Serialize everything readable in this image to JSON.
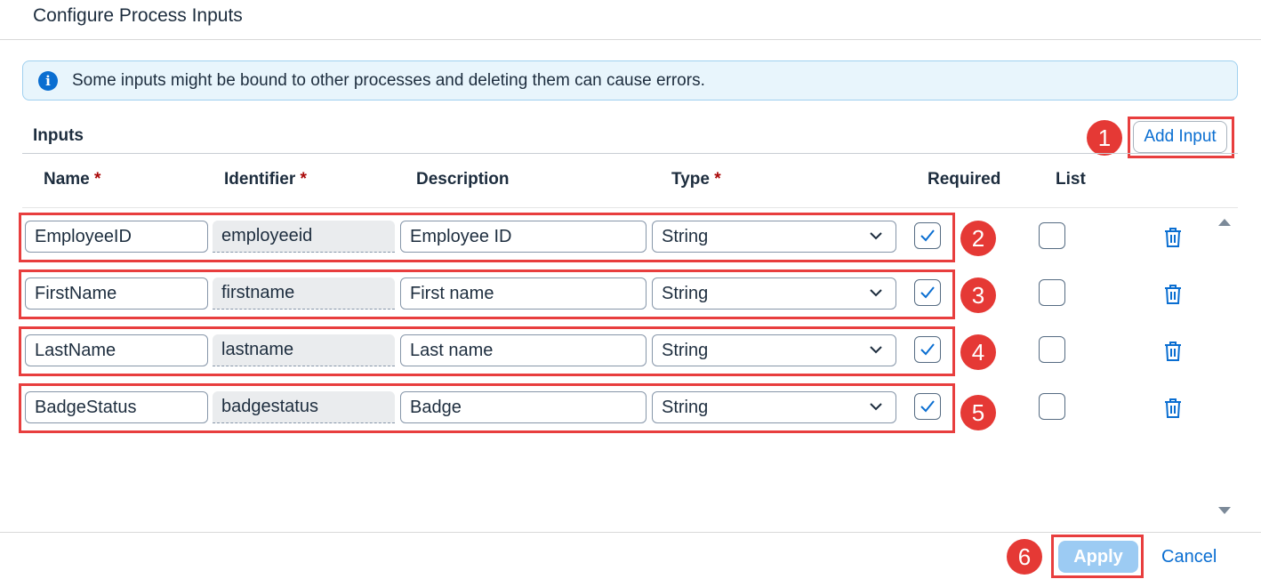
{
  "dialog": {
    "title": "Configure Process Inputs"
  },
  "info": {
    "icon": "info-icon",
    "text": "Some inputs might be bound to other processes and deleting them can cause errors."
  },
  "inputs": {
    "section_label": "Inputs",
    "add_label": "Add Input",
    "columns": {
      "name": "Name",
      "identifier": "Identifier",
      "description": "Description",
      "type": "Type",
      "required": "Required",
      "list": "List",
      "required_marker": "*"
    },
    "rows": [
      {
        "name": "EmployeeID",
        "identifier": "employeeid",
        "description": "Employee ID",
        "type": "String",
        "required": true,
        "list": false
      },
      {
        "name": "FirstName",
        "identifier": "firstname",
        "description": "First name",
        "type": "String",
        "required": true,
        "list": false
      },
      {
        "name": "LastName",
        "identifier": "lastname",
        "description": "Last name",
        "type": "String",
        "required": true,
        "list": false
      },
      {
        "name": "BadgeStatus",
        "identifier": "badgestatus",
        "description": "Badge",
        "type": "String",
        "required": true,
        "list": false
      }
    ]
  },
  "callouts": [
    "1",
    "2",
    "3",
    "4",
    "5",
    "6"
  ],
  "footer": {
    "apply_label": "Apply",
    "cancel_label": "Cancel"
  },
  "colors": {
    "accent": "#0a6ed1",
    "callout": "#e53935",
    "highlight_box": "#e83e3e",
    "info_bg": "#e8f5fc"
  }
}
